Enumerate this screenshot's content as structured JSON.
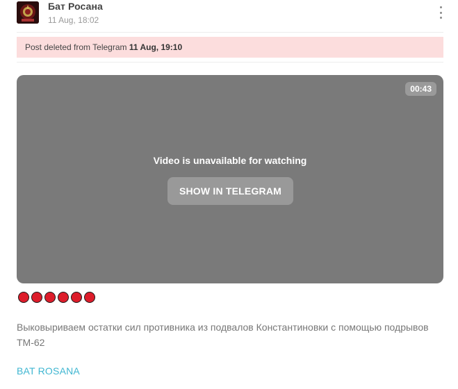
{
  "header": {
    "channel_name": "Бат Росана",
    "date": "11 Aug, 18:02",
    "avatar_icon": "channel-emblem-icon",
    "menu_icon": "vertical-dots-icon"
  },
  "deleted_banner": {
    "text": "Post deleted from Telegram",
    "date": "11 Aug, 19:10"
  },
  "video": {
    "duration": "00:43",
    "unavailable_text": "Video is unavailable for watching",
    "button_label": "SHOW IN TELEGRAM"
  },
  "emojis": {
    "count": 6,
    "icon": "red-circle-icon",
    "color": "#dd1d2b"
  },
  "post": {
    "text": "Выковыриваем остатки сил противника из подвалов Константиновки с помощью подрывов ТМ-62",
    "signature": "BAT ROSANA"
  },
  "colors": {
    "banner_bg": "#fcdddd",
    "video_bg": "#7a7a7a",
    "link": "#3fb6d1"
  }
}
